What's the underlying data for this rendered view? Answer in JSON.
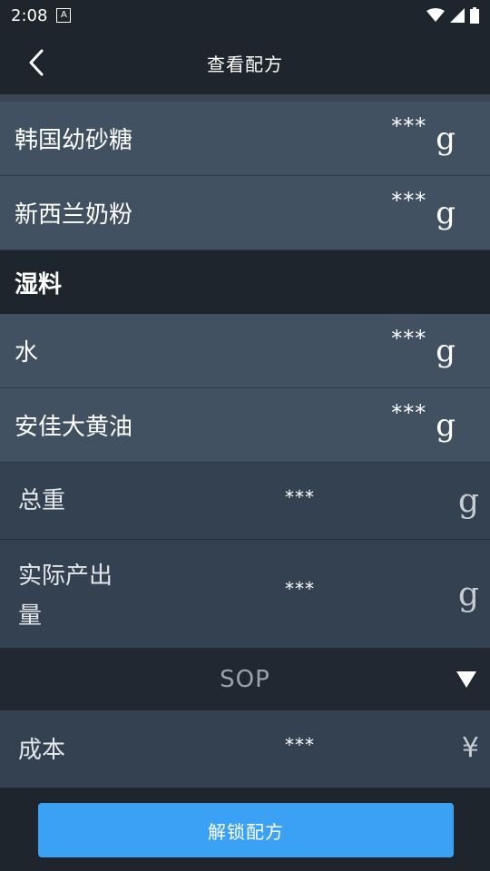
{
  "status_bar": {
    "time": "2:08",
    "badge": "A"
  },
  "header": {
    "title": "查看配方"
  },
  "ingredients_top": [
    {
      "name": "韩国幼砂糖",
      "value": "***",
      "unit": "g"
    },
    {
      "name": "新西兰奶粉",
      "value": "***",
      "unit": "g"
    }
  ],
  "section_wet": {
    "title": "湿料"
  },
  "ingredients_wet": [
    {
      "name": "水",
      "value": "***",
      "unit": "g"
    },
    {
      "name": "安佳大黄油",
      "value": "***",
      "unit": "g"
    }
  ],
  "summary": {
    "total_weight": {
      "label": "总重",
      "value": "***",
      "unit": "g"
    },
    "actual_output": {
      "label_line1": "实际产出",
      "label_line2": "量",
      "value": "***",
      "unit": "g"
    }
  },
  "sop": {
    "label": "SOP"
  },
  "cost": {
    "label": "成本",
    "value": "***",
    "unit": "¥"
  },
  "footer": {
    "unlock_label": "解锁配方"
  },
  "colors": {
    "background": "#1f252d",
    "ingredient_row": "#415161",
    "summary_row": "#344150",
    "primary_button": "#3aa1f5"
  },
  "icons": {
    "back": "chevron-left-icon",
    "sop_toggle": "triangle-down-icon",
    "wifi": "wifi-icon",
    "signal": "signal-icon",
    "battery": "battery-icon"
  }
}
